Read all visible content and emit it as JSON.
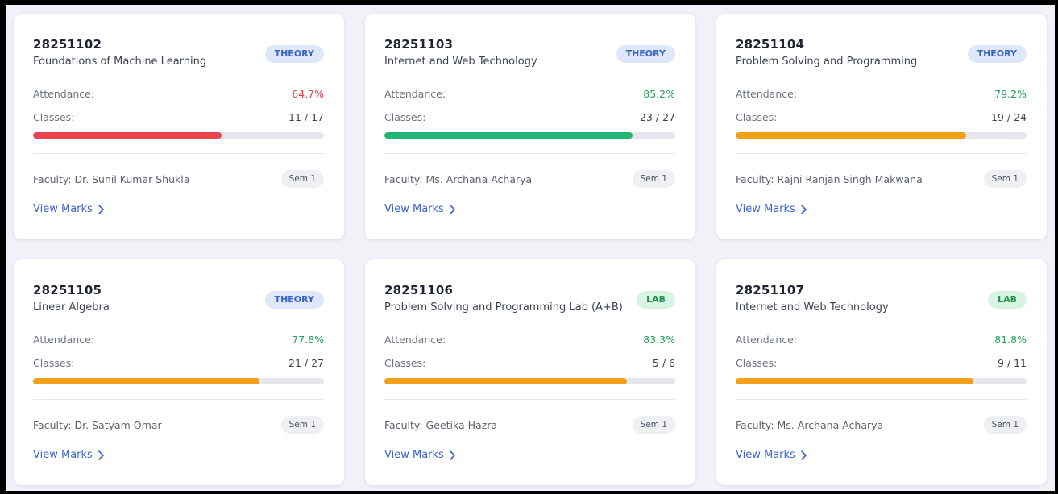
{
  "colors": {
    "red": "#e8464f",
    "green": "#22b574",
    "orange": "#f0a019",
    "link": "#3b63d0"
  },
  "courses": [
    {
      "code": "28251102",
      "name": "Foundations of Machine Learning",
      "type": "THEORY",
      "attendance_label": "Attendance:",
      "attendance": "64.7%",
      "attendance_fraction": 0.647,
      "status": "red",
      "classes_label": "Classes:",
      "classes": "11 / 17",
      "faculty": "Faculty: Dr. Sunil Kumar Shukla",
      "sem": "Sem 1",
      "link": "View Marks"
    },
    {
      "code": "28251103",
      "name": "Internet and Web Technology",
      "type": "THEORY",
      "attendance_label": "Attendance:",
      "attendance": "85.2%",
      "attendance_fraction": 0.852,
      "status": "green",
      "classes_label": "Classes:",
      "classes": "23 / 27",
      "faculty": "Faculty: Ms. Archana Acharya",
      "sem": "Sem 1",
      "link": "View Marks"
    },
    {
      "code": "28251104",
      "name": "Problem Solving and Programming",
      "type": "THEORY",
      "attendance_label": "Attendance:",
      "attendance": "79.2%",
      "attendance_fraction": 0.792,
      "status": "orange",
      "classes_label": "Classes:",
      "classes": "19 / 24",
      "faculty": "Faculty: Rajni Ranjan Singh Makwana",
      "sem": "Sem 1",
      "link": "View Marks"
    },
    {
      "code": "28251105",
      "name": "Linear Algebra",
      "type": "THEORY",
      "attendance_label": "Attendance:",
      "attendance": "77.8%",
      "attendance_fraction": 0.778,
      "status": "orange",
      "classes_label": "Classes:",
      "classes": "21 / 27",
      "faculty": "Faculty: Dr. Satyam Omar",
      "sem": "Sem 1",
      "link": "View Marks"
    },
    {
      "code": "28251106",
      "name": "Problem Solving and Programming Lab (A+B)",
      "type": "LAB",
      "attendance_label": "Attendance:",
      "attendance": "83.3%",
      "attendance_fraction": 0.833,
      "status": "orange",
      "classes_label": "Classes:",
      "classes": "5 / 6",
      "faculty": "Faculty: Geetika Hazra",
      "sem": "Sem 1",
      "link": "View Marks"
    },
    {
      "code": "28251107",
      "name": "Internet and Web Technology",
      "type": "LAB",
      "attendance_label": "Attendance:",
      "attendance": "81.8%",
      "attendance_fraction": 0.818,
      "status": "orange",
      "classes_label": "Classes:",
      "classes": "9 / 11",
      "faculty": "Faculty: Ms. Archana Acharya",
      "sem": "Sem 1",
      "link": "View Marks"
    }
  ]
}
